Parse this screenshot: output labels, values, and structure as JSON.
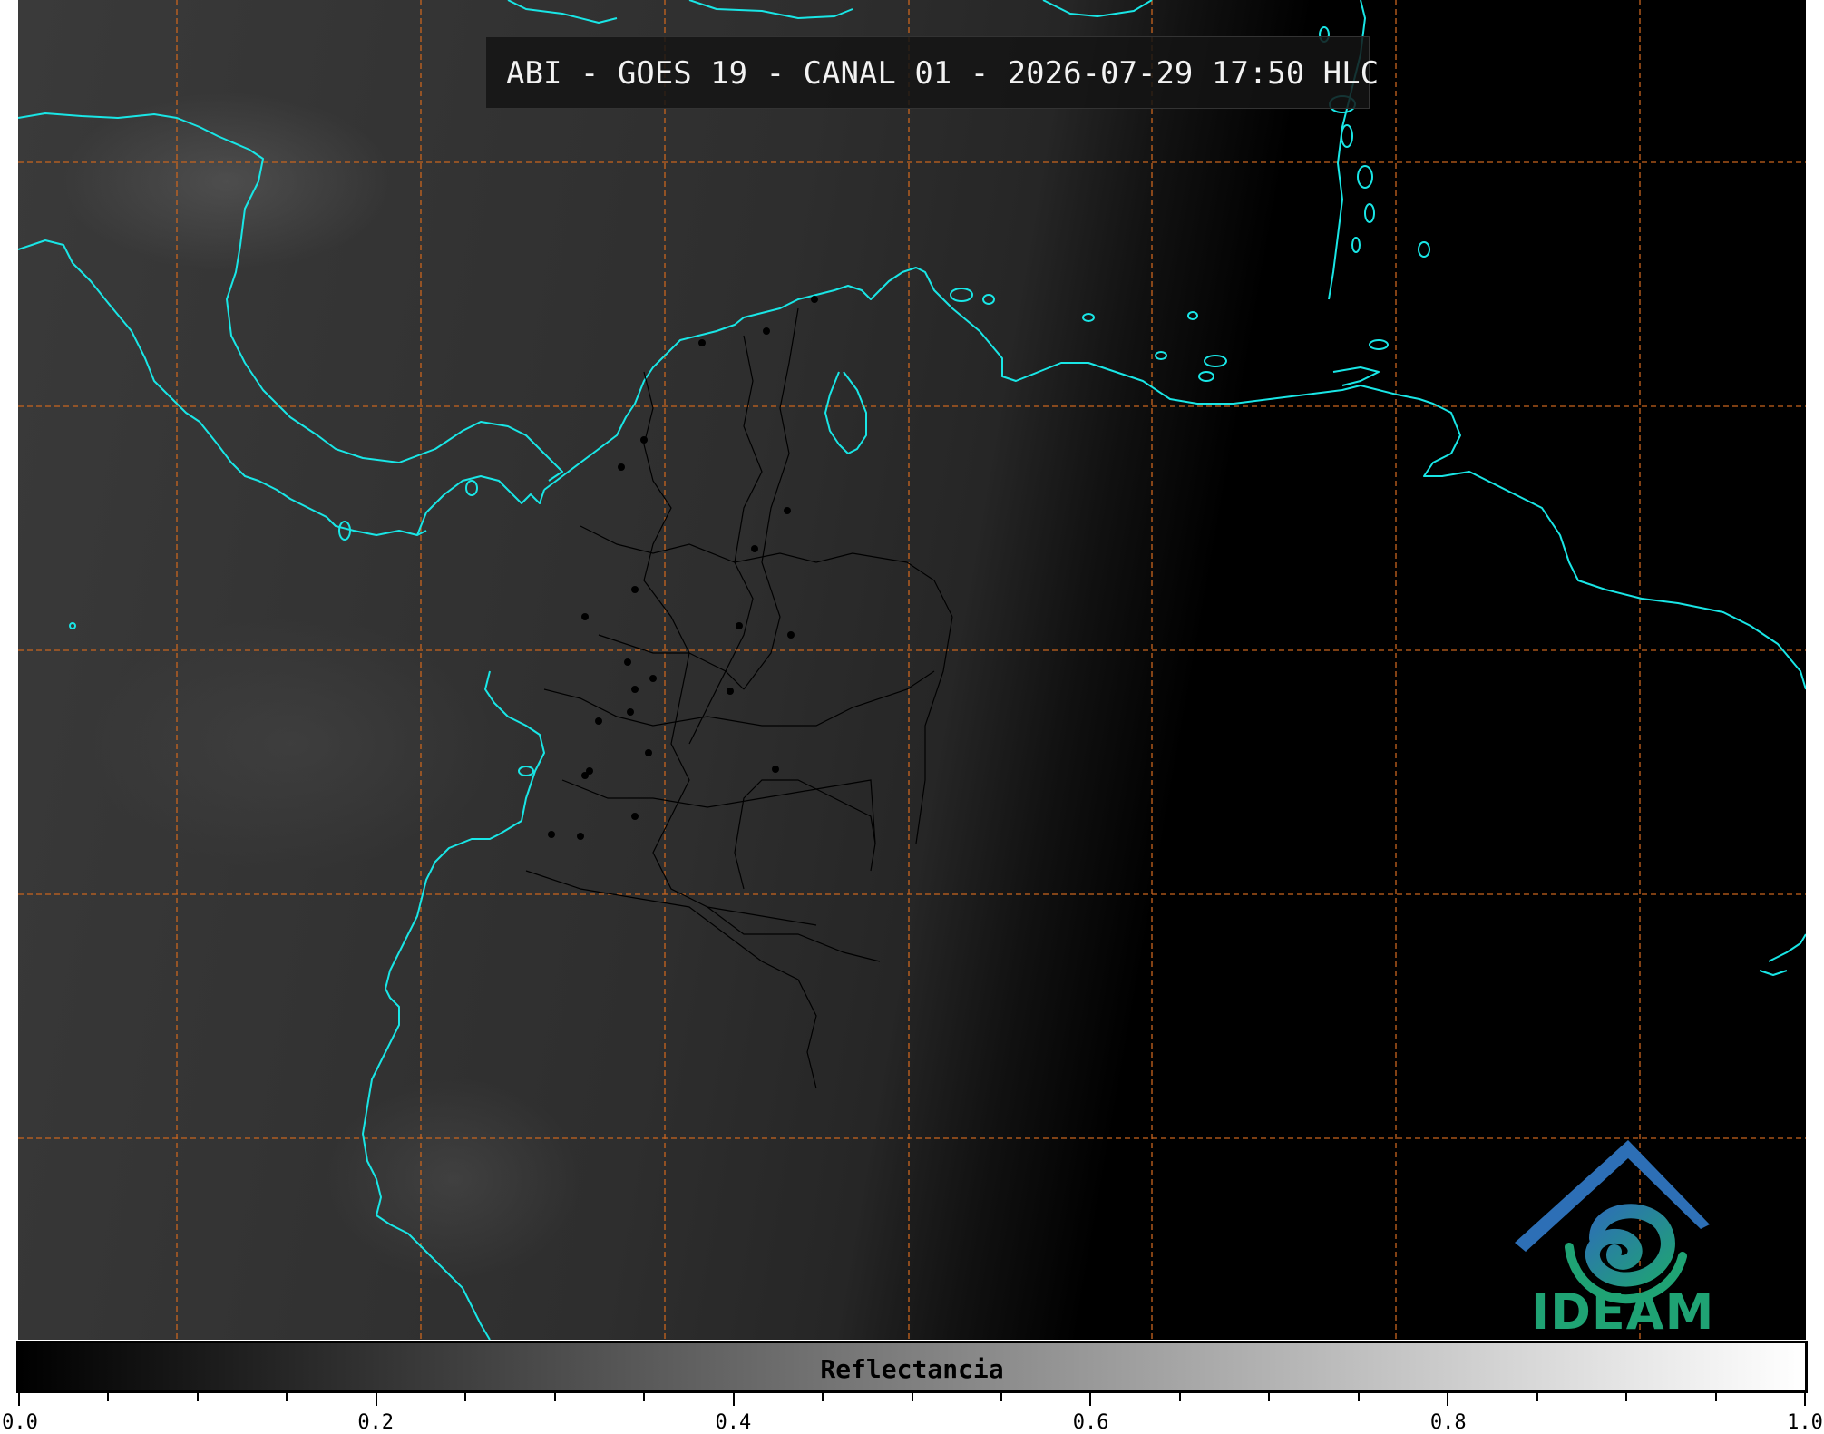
{
  "title": "ABI - GOES 19 - CANAL 01 - 2026-07-29 17:50 HLC",
  "logo": {
    "text": "IDEAM"
  },
  "colorbar": {
    "label": "Reflectancia",
    "ticks": [
      "0.0",
      "0.2",
      "0.4",
      "0.6",
      "0.8",
      "1.0"
    ]
  },
  "colors": {
    "coastline": "#19e6e6",
    "grid": "#c8641e",
    "borders": "#000000",
    "logo_blue": "#2d6fb6",
    "logo_green": "#1fa374"
  }
}
